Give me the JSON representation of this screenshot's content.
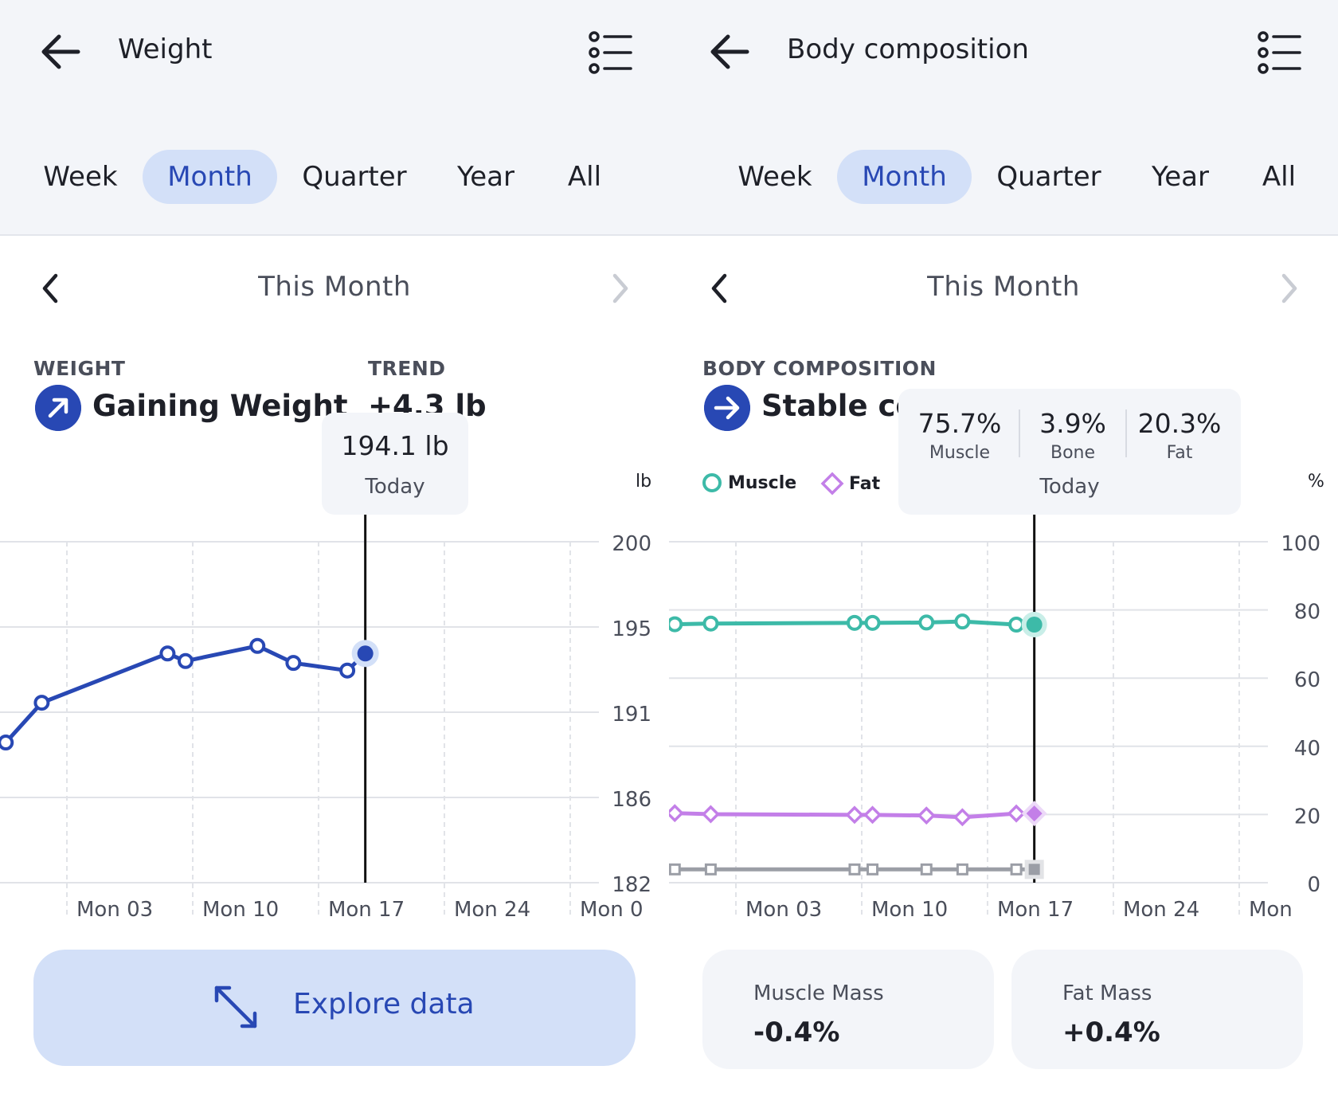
{
  "colors": {
    "accent": "#2848b4",
    "tab_active_bg": "#d3e0f8",
    "muscle": "#3dbaa8",
    "fat": "#c37fe8",
    "bone": "#9b9ea6"
  },
  "weight_panel": {
    "title": "Weight",
    "tabs": [
      "Week",
      "Month",
      "Quarter",
      "Year",
      "All"
    ],
    "active_tab": "Month",
    "period_label": "This Month",
    "section_label": "WEIGHT",
    "status": "Gaining Weight",
    "trend_label": "TREND",
    "trend_value": "+4.3 lb",
    "tooltip": {
      "value": "194.1 lb",
      "sub": "Today"
    },
    "unit": "lb",
    "explore_label": "Explore data"
  },
  "body_panel": {
    "title": "Body composition",
    "tabs": [
      "Week",
      "Month",
      "Quarter",
      "Year",
      "All"
    ],
    "active_tab": "Month",
    "period_label": "This Month",
    "section_label": "BODY COMPOSITION",
    "status": "Stable co",
    "legend": [
      "Muscle",
      "Fat"
    ],
    "tooltip": {
      "items": [
        {
          "value": "75.7%",
          "label": "Muscle"
        },
        {
          "value": "3.9%",
          "label": "Bone"
        },
        {
          "value": "20.3%",
          "label": "Fat"
        }
      ],
      "sub": "Today"
    },
    "unit": "%",
    "stats": [
      {
        "label": "Muscle Mass",
        "value": "-0.4%"
      },
      {
        "label": "Fat Mass",
        "value": "+0.4%"
      }
    ]
  },
  "chart_data": [
    {
      "type": "line",
      "name": "weight",
      "x_tick_labels": [
        "Mon 03",
        "Mon 10",
        "Mon 17",
        "Mon 24",
        "Mon 0"
      ],
      "y_tick_labels": [
        "200",
        "195",
        "191",
        "186",
        "182"
      ],
      "ylim": [
        182,
        200
      ],
      "grid": true,
      "points_day_offset_from_mon03": [
        -3.4,
        -1.4,
        5.6,
        6.6,
        10.6,
        12.6,
        15.6
      ],
      "values": [
        189.4,
        191.5,
        194.1,
        193.7,
        194.5,
        193.6,
        193.2
      ],
      "today": {
        "day_offset_from_mon03": 16.6,
        "value": 194.1
      }
    },
    {
      "type": "line",
      "name": "body composition",
      "x_tick_labels": [
        "Mon 03",
        "Mon 10",
        "Mon 17",
        "Mon 24",
        "Mon"
      ],
      "y_tick_labels": [
        "100",
        "80",
        "60",
        "40",
        "20",
        "0"
      ],
      "ylim": [
        0,
        100
      ],
      "grid": true,
      "points_day_offset_from_mon03": [
        -3.4,
        -1.4,
        6.6,
        7.6,
        10.6,
        12.6,
        15.6
      ],
      "series": [
        {
          "name": "Muscle",
          "values": [
            75.8,
            76.0,
            76.2,
            76.2,
            76.3,
            76.6,
            75.7
          ]
        },
        {
          "name": "Fat",
          "values": [
            20.4,
            20.1,
            19.9,
            19.9,
            19.7,
            19.2,
            20.3
          ]
        },
        {
          "values": [
            3.9,
            3.9,
            3.9,
            3.9,
            3.9,
            3.9,
            3.9
          ]
        }
      ],
      "today": {
        "day_offset_from_mon03": 16.6,
        "values": [
          75.7,
          20.3,
          3.9
        ]
      }
    }
  ]
}
